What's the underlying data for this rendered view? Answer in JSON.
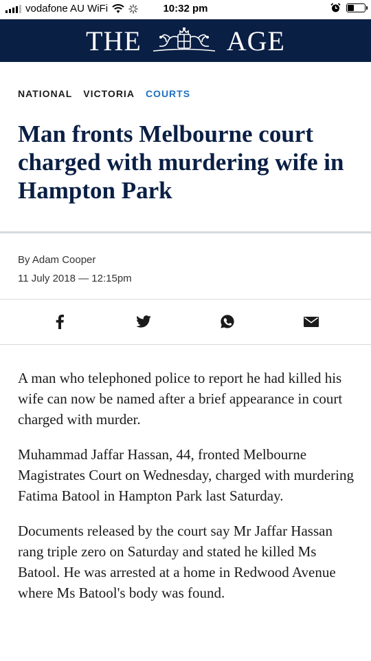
{
  "status_bar": {
    "carrier": "vodafone AU WiFi",
    "time": "10:32 pm"
  },
  "masthead": {
    "left_word": "THE",
    "right_word": "AGE"
  },
  "breadcrumb": {
    "items": [
      "NATIONAL",
      "VICTORIA",
      "COURTS"
    ],
    "active": "COURTS",
    "active_color": "#1f6fbf"
  },
  "article": {
    "headline": "Man fronts Melbourne court charged with murdering wife in Hampton Park",
    "byline": "By Adam Cooper",
    "dateline": "11 July 2018 — 12:15pm",
    "paragraphs": [
      "A man who telephoned police to report he had killed his wife can now be named after a brief appearance in court charged with murder.",
      "Muhammad Jaffar Hassan, 44, fronted Melbourne Magistrates Court on Wednesday, charged with murdering Fatima Batool in Hampton Park last Saturday.",
      "Documents released by the court say Mr Jaffar Hassan rang triple zero on Saturday and stated he killed Ms Batool. He was arrested at a home in Redwood Avenue where Ms Batool's body was found."
    ]
  },
  "share": {
    "icons": [
      "facebook-icon",
      "twitter-icon",
      "whatsapp-icon",
      "email-icon"
    ]
  },
  "colors": {
    "brand_navy": "#0a1f44",
    "accent_blue": "#1f6fbf"
  }
}
